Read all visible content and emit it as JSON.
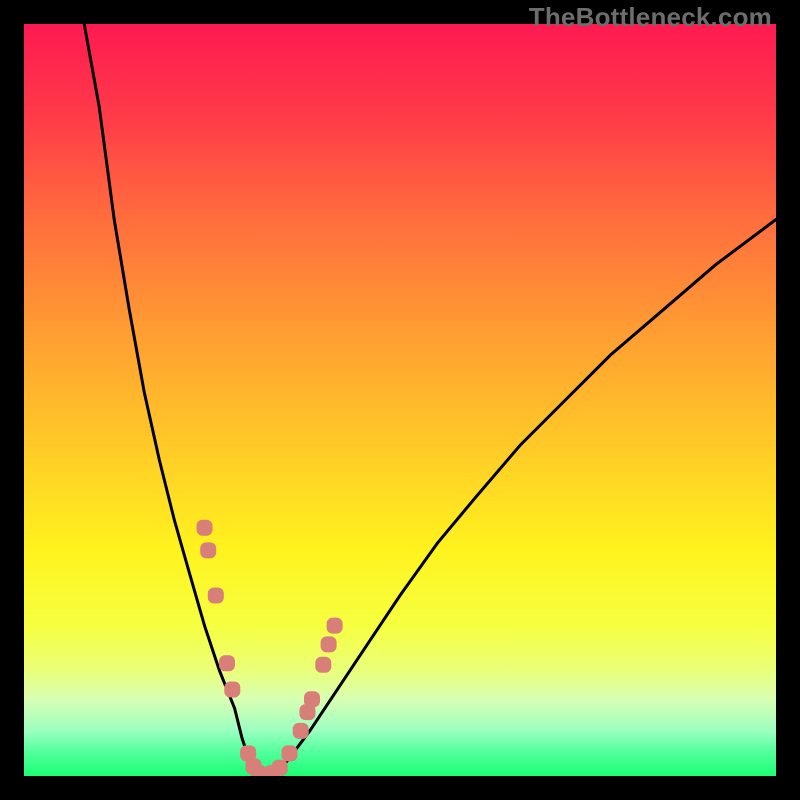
{
  "watermark": "TheBottleneck.com",
  "chart_data": {
    "type": "line",
    "title": "",
    "xlabel": "",
    "ylabel": "",
    "xlim": [
      0,
      100
    ],
    "ylim": [
      0,
      100
    ],
    "grid": false,
    "background": "thermal-gradient (red→orange→yellow→green, top→bottom)",
    "series": [
      {
        "name": "left-curve",
        "x": [
          8,
          10,
          12,
          14,
          16,
          18,
          20,
          22,
          24,
          26,
          28,
          29,
          30,
          31
        ],
        "y": [
          100,
          89,
          74,
          62,
          51,
          42,
          34,
          27,
          20,
          14,
          9,
          5,
          2,
          0
        ],
        "color": "#000000"
      },
      {
        "name": "right-curve",
        "x": [
          33,
          35,
          38,
          42,
          46,
          50,
          55,
          60,
          66,
          72,
          78,
          85,
          92,
          100
        ],
        "y": [
          0,
          2,
          6,
          12,
          18,
          24,
          31,
          37,
          44,
          50,
          56,
          62,
          68,
          74
        ],
        "color": "#000000"
      },
      {
        "name": "dot-markers",
        "x": [
          24.0,
          24.5,
          25.5,
          27.0,
          27.7,
          29.8,
          30.5,
          31.2,
          33.0,
          34.0,
          35.3,
          36.8,
          37.7,
          38.3,
          39.8,
          40.5,
          41.3
        ],
        "y": [
          33.0,
          30.0,
          24.0,
          15.0,
          11.5,
          3.0,
          1.3,
          0.4,
          0.4,
          1.1,
          3.0,
          6.0,
          8.5,
          10.2,
          14.8,
          17.5,
          20.0
        ],
        "color": "#d87f7a",
        "marker": "rounded-square"
      }
    ],
    "gradient_stops": [
      {
        "offset": 0.0,
        "color": "#ff1a52"
      },
      {
        "offset": 0.12,
        "color": "#ff3a49"
      },
      {
        "offset": 0.25,
        "color": "#ff6a3e"
      },
      {
        "offset": 0.4,
        "color": "#ff9a33"
      },
      {
        "offset": 0.55,
        "color": "#ffc728"
      },
      {
        "offset": 0.7,
        "color": "#fff31e"
      },
      {
        "offset": 0.8,
        "color": "#f6ff40"
      },
      {
        "offset": 0.86,
        "color": "#eaff7a"
      },
      {
        "offset": 0.9,
        "color": "#d6ffb4"
      },
      {
        "offset": 0.94,
        "color": "#9affc0"
      },
      {
        "offset": 0.97,
        "color": "#4eff9a"
      },
      {
        "offset": 1.0,
        "color": "#1aff74"
      }
    ]
  }
}
